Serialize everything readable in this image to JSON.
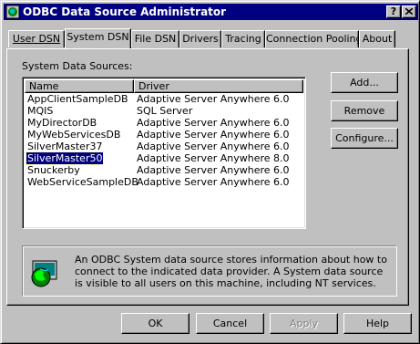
{
  "window": {
    "title": "ODBC Data Source Administrator",
    "help_btn": "?",
    "close_btn": "✕"
  },
  "tabs": [
    "User DSN",
    "System DSN",
    "File DSN",
    "Drivers",
    "Tracing",
    "Connection Pooling",
    "About"
  ],
  "active_tab": "System DSN",
  "panel": {
    "sources_label": "System Data Sources:",
    "columns": {
      "name": "Name",
      "driver": "Driver"
    },
    "rows": [
      {
        "name": "AppClientSampleDB",
        "driver": "Adaptive Server Anywhere 6.0"
      },
      {
        "name": "MQIS",
        "driver": "SQL Server"
      },
      {
        "name": "MyDirectorDB",
        "driver": "Adaptive Server Anywhere 6.0"
      },
      {
        "name": "MyWebServicesDB",
        "driver": "Adaptive Server Anywhere 6.0"
      },
      {
        "name": "SilverMaster37",
        "driver": "Adaptive Server Anywhere 6.0"
      },
      {
        "name": "SilverMaster50",
        "driver": "Adaptive Server Anywhere 8.0"
      },
      {
        "name": "Snuckerby",
        "driver": "Adaptive Server Anywhere 6.0"
      },
      {
        "name": "WebServiceSampleDB",
        "driver": "Adaptive Server Anywhere 6.0"
      }
    ],
    "selected_row": "SilverMaster50",
    "buttons": {
      "add": "Add...",
      "remove": "Remove",
      "configure": "Configure..."
    },
    "info_text": "An ODBC System data source stores information about how to connect to the indicated data provider.  A System data source is visible to all users on this machine, including NT services."
  },
  "footer": {
    "ok": "OK",
    "cancel": "Cancel",
    "apply": "Apply",
    "help": "Help"
  },
  "colors": {
    "titlebar": "#000080",
    "face": "#c0c0c0",
    "selection": "#000080"
  },
  "icons": {
    "app": "odbc-app-icon",
    "info": "odbc-globe-icon"
  }
}
